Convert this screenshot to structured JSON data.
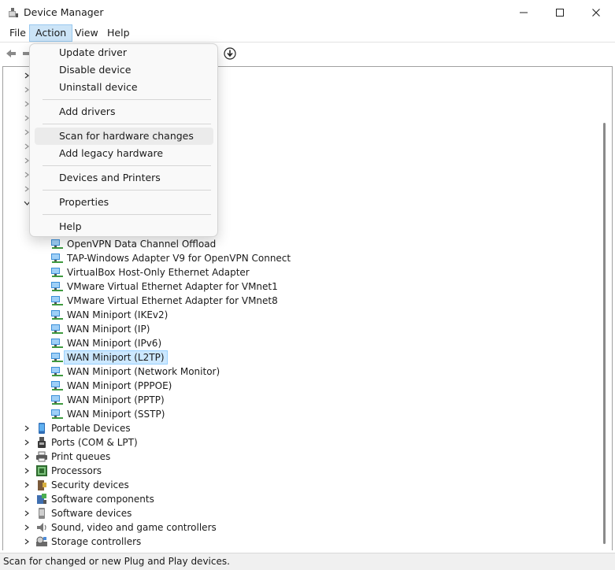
{
  "window": {
    "title": "Device Manager"
  },
  "menubar": {
    "items": [
      "File",
      "Action",
      "View",
      "Help"
    ],
    "active": "Action"
  },
  "action_menu": {
    "items": [
      "Update driver",
      "Disable device",
      "Uninstall device",
      "Add drivers",
      "Scan for hardware changes",
      "Add legacy hardware",
      "Devices and Printers",
      "Properties",
      "Help"
    ],
    "hovered": "Scan for hardware changes"
  },
  "tree": {
    "network_children": [
      "OpenVPN Data Channel Offload",
      "TAP-Windows Adapter V9 for OpenVPN Connect",
      "VirtualBox Host-Only Ethernet Adapter",
      "VMware Virtual Ethernet Adapter for VMnet1",
      "VMware Virtual Ethernet Adapter for VMnet8",
      "WAN Miniport (IKEv2)",
      "WAN Miniport (IP)",
      "WAN Miniport (IPv6)",
      "WAN Miniport (L2TP)",
      "WAN Miniport (Network Monitor)",
      "WAN Miniport (PPPOE)",
      "WAN Miniport (PPTP)",
      "WAN Miniport (SSTP)"
    ],
    "selected": "WAN Miniport (L2TP)",
    "categories": [
      "Portable Devices",
      "Ports (COM & LPT)",
      "Print queues",
      "Processors",
      "Security devices",
      "Software components",
      "Software devices",
      "Sound, video and game controllers",
      "Storage controllers"
    ]
  },
  "statusbar": {
    "text": "Scan for changed or new Plug and Play devices."
  },
  "colors": {
    "accent": "#0067c0",
    "selection": "#cce8ff",
    "menu_active": "#cce4f7"
  }
}
